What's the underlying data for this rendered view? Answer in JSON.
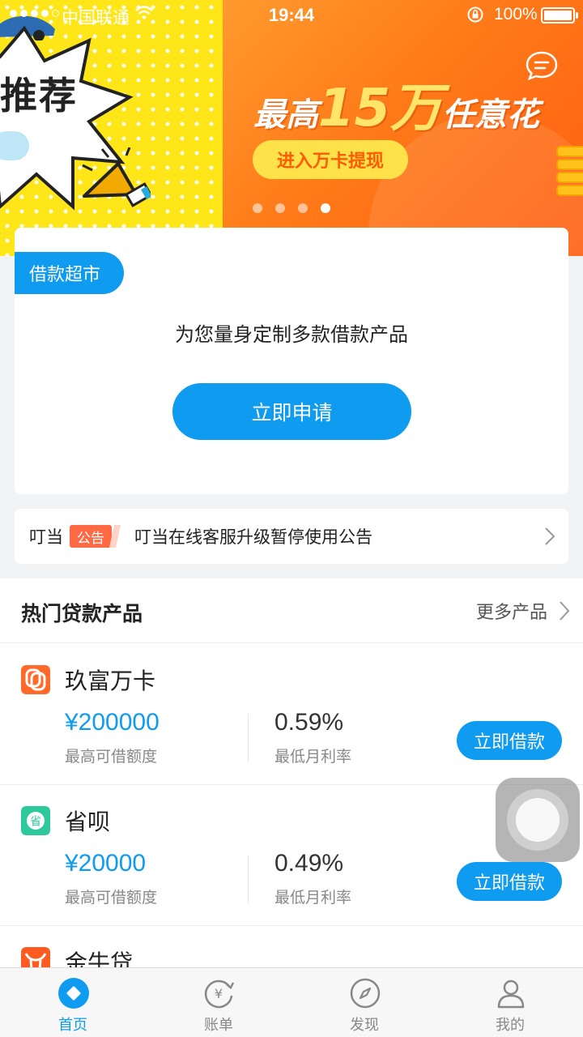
{
  "status_bar": {
    "carrier": "中国联通",
    "time": "19:44",
    "battery": "100%"
  },
  "banner": {
    "left_partial_text": "推荐",
    "headline_prefix": "最高",
    "headline_amount": "15万",
    "headline_suffix": "任意花",
    "cta": "进入万卡提现",
    "active_slide": 4,
    "slide_count": 4,
    "icons": [
      "car-icon",
      "megaphone-icon",
      "chat-icon"
    ]
  },
  "loan_market": {
    "tag": "借款超市",
    "description": "为您量身定制多款借款产品",
    "apply_button": "立即申请"
  },
  "notice": {
    "brand": "叮当",
    "tag": "公告",
    "text": "叮当在线客服升级暂停使用公告"
  },
  "hot_products": {
    "title": "热门贷款产品",
    "more": "更多产品",
    "items": [
      {
        "name": "玖富万卡",
        "amount": "¥200000",
        "amount_label": "最高可借额度",
        "rate": "0.59%",
        "rate_label": "最低月利率",
        "button": "立即借款",
        "logo_color": "#ff6a2a"
      },
      {
        "name": "省呗",
        "amount": "¥20000",
        "amount_label": "最高可借额度",
        "rate": "0.49%",
        "rate_label": "最低月利率",
        "button": "立即借款",
        "logo_color": "#2ec99a"
      },
      {
        "name": "金牛贷",
        "logo_color": "#ff5a1f"
      }
    ]
  },
  "tabbar": {
    "items": [
      {
        "label": "首页",
        "icon": "home-icon",
        "active": true
      },
      {
        "label": "账单",
        "icon": "bill-icon",
        "active": false
      },
      {
        "label": "发现",
        "icon": "compass-icon",
        "active": false
      },
      {
        "label": "我的",
        "icon": "profile-icon",
        "active": false
      }
    ]
  },
  "colors": {
    "primary": "#0e9bf0",
    "banner_yellow": "#ffe619",
    "banner_orange": "#ff7a19",
    "notice_tag": "#ff6a45"
  }
}
